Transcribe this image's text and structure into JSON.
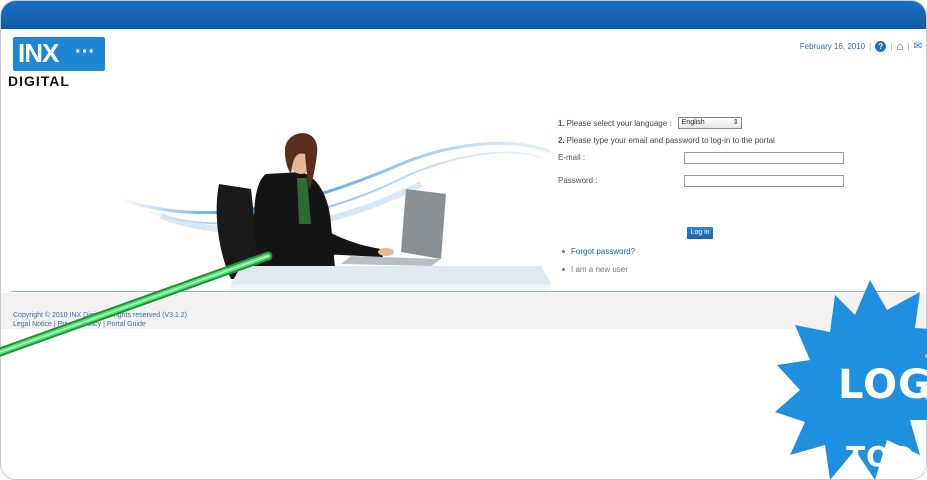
{
  "header": {
    "logo": {
      "brand": "INX",
      "dots": "···",
      "tagline": "DIGITAL"
    },
    "utility": {
      "date": "February 16, 2010",
      "sep1": "|",
      "sep2": "|",
      "sep3": "|",
      "help_icon": "help-icon",
      "home_icon": "home-icon",
      "mail_icon": "mail-icon"
    }
  },
  "form": {
    "step1_num": "1.",
    "step1_text": "Please select your language :",
    "language_value": "English",
    "step2_num": "2.",
    "step2_text": "Please type your email and password to log-in to the portal",
    "email_label": "E-mail :",
    "password_label": "Password :",
    "login_label": "Log in",
    "forgot_label": "Forgot password?",
    "new_user_label": "I am a new user"
  },
  "footer": {
    "line1": "Copyright © 2010 INX Digital All rights reserved (V3.1.2)",
    "line2": "Legal Notice | Privacy Policy | Portal Guide"
  },
  "promo": {
    "line1": "LOG",
    "line2": "TOD"
  },
  "colors": {
    "topbar": "#1167b8",
    "brand_blue": "#1f86d4",
    "promo_blue": "#1f8fe0",
    "laser_green": "#3ef06a"
  }
}
